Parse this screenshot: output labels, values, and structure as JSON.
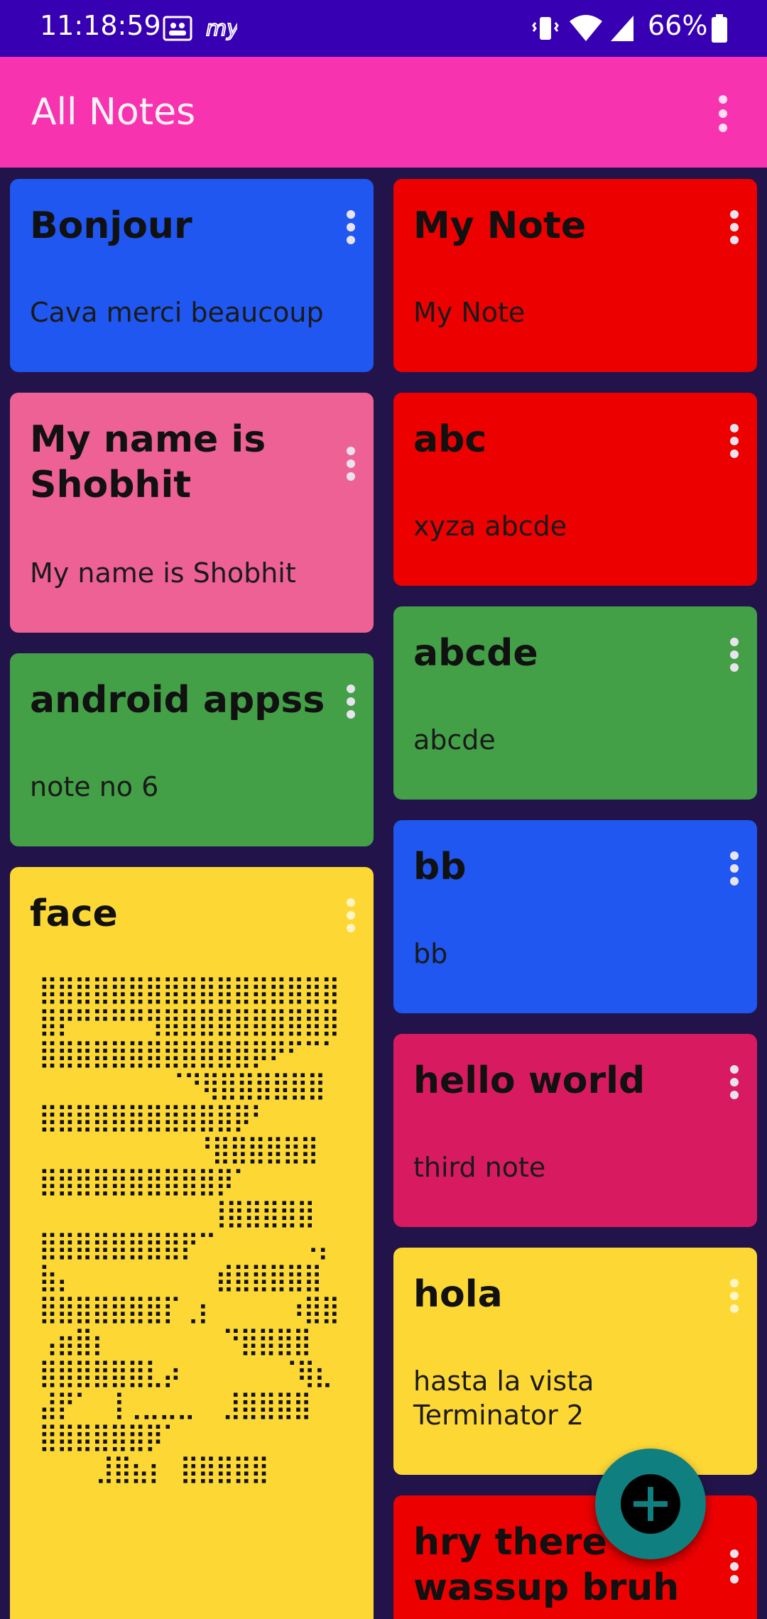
{
  "status_bar": {
    "time": "11:18:59",
    "battery": "66%"
  },
  "app_bar": {
    "title": "All Notes"
  },
  "colors": {
    "blue": "#1f57f0",
    "red": "#ec0000",
    "pink": "#ee6194",
    "green": "#43a047",
    "yellow": "#fdd835",
    "magenta": "#d81b60",
    "status_bar": "#3700b3",
    "app_bar": "#f833b0",
    "background": "#22144a",
    "fab": "#0f7f7f"
  },
  "notes_left": [
    {
      "title": "Bonjour",
      "body": "Cava merci beaucoup"
    },
    {
      "title": "My name is Shobhit",
      "body": "My name is Shobhit"
    },
    {
      "title": "android appss",
      "body": "note no 6"
    },
    {
      "title": "face",
      "body": "⣿⣿⣿⣿⣿⣿⣿⣿⣿⣿⣿⣿⣿⣿⣿⣿⣿\n⣿⡟⠛⠛⠛⠛⢻⣿⣿⣿⣿⣿⣿⣿⣿⣿⣿\n⣿⣿⣿⣿⣿⣿⣿⣿⣿⣿⣿⣿⡿⠟⠋⠉⠁\n         ⠈⠙⢿⣿⣿⣿⣿⣿⣿\n⣿⣿⣿⣿⣿⣿⣿⣿⣿⣿⣿⡿⠃\n           ⠘⣿⣿⣿⣿⣿⣿\n⣿⣿⣿⣿⣿⣿⣿⣿⣿⣿⡿⠁\n            ⢸⣿⣿⣿⣿⣿\n⣿⣿⣿⣿⣿⣿⣿⣿⡟⠉      ⠠⡄\n⣷⡄          ⣾⣿⣿⣿⣿⣿\n⣿⣿⣿⣿⣿⣿⣿⡏⢀⡆     ⠰⣿⣿\n⢠⣶⣿⡆        ⠙⣿⣿⣿⣿\n⣿⣿⣿⣿⣿⣿⣇⡴       ⠈⢿⣆\n⣼⡟⠁ ⢸⢀⣀⣀⣀  ⣸⣿⣿⣿⣿\n⣿⣿⣿⣿⣿⣿⡿⠁\n    ⣸⣿⣦⡆ ⣿⣿⣿⣿⣿"
    }
  ],
  "notes_right": [
    {
      "title": "My Note",
      "body": "My Note"
    },
    {
      "title": "abc",
      "body": "xyza abcde"
    },
    {
      "title": "abcde",
      "body": "abcde"
    },
    {
      "title": "bb",
      "body": "bb"
    },
    {
      "title": "hello world",
      "body": "third note"
    },
    {
      "title": "hola",
      "body": "hasta la vista Terminator 2"
    },
    {
      "title": "hry there wassup bruh",
      "body": ""
    }
  ],
  "icons": {
    "fab": "add-icon",
    "card_menu": "more-vert-icon",
    "app_menu": "more-vert-icon"
  }
}
